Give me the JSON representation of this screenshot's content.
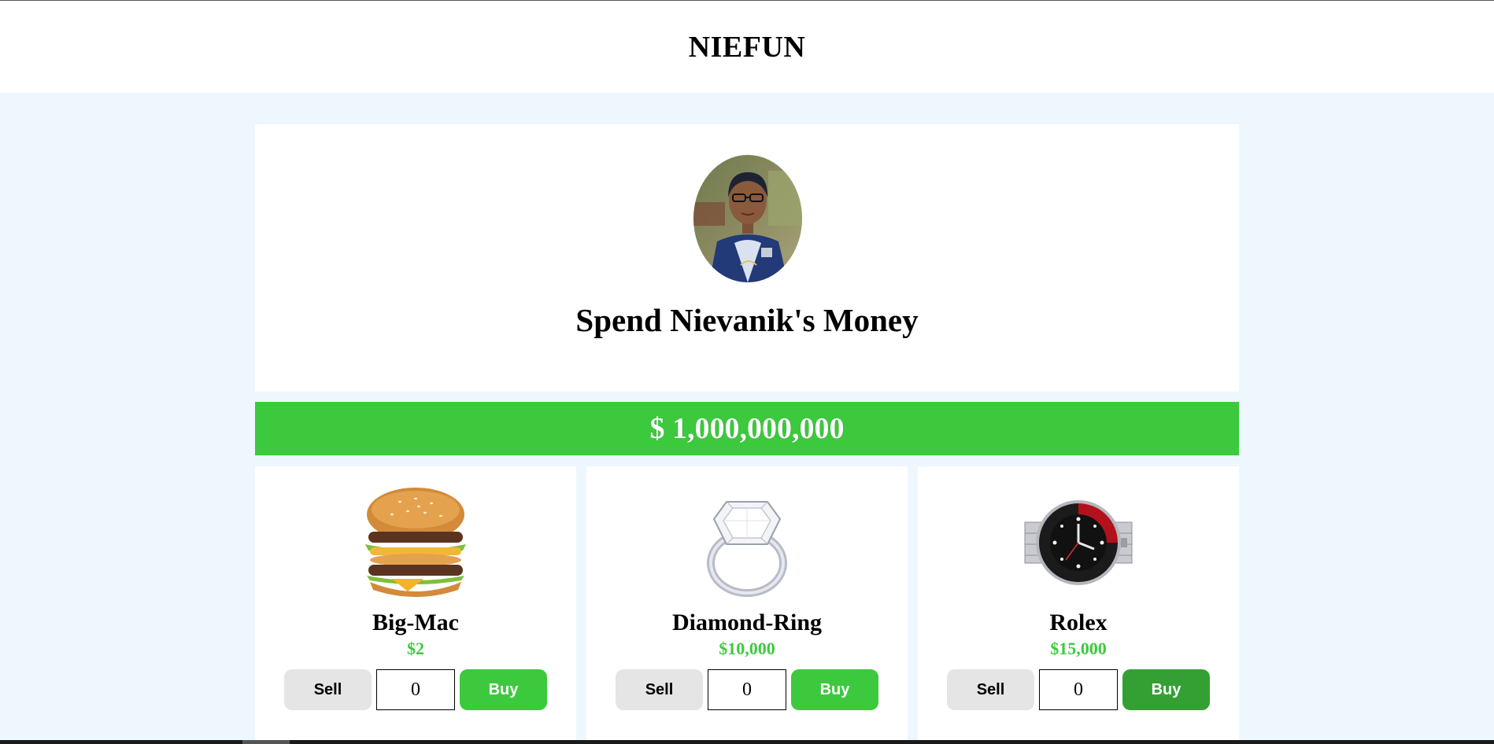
{
  "header": {
    "brand": "NIEFUN"
  },
  "profile": {
    "avatar_icon": "person-portrait-photo",
    "headline": "Spend Nievanik's Money"
  },
  "balance": {
    "text": "$ 1,000,000,000"
  },
  "colors": {
    "accent_green": "#3dc93d",
    "buy_active_green": "#34a034",
    "page_background": "#eef6fe",
    "sell_button_gray": "#e5e5e5"
  },
  "products": [
    {
      "name": "Big-Mac",
      "price": "$2",
      "image_icon": "burger-image",
      "sell_label": "Sell",
      "buy_label": "Buy",
      "quantity": "0"
    },
    {
      "name": "Diamond-Ring",
      "price": "$10,000",
      "image_icon": "diamond-ring-image",
      "sell_label": "Sell",
      "buy_label": "Buy",
      "quantity": "0"
    },
    {
      "name": "Rolex",
      "price": "$15,000",
      "image_icon": "watch-image",
      "sell_label": "Sell",
      "buy_label": "Buy",
      "quantity": "0"
    }
  ]
}
